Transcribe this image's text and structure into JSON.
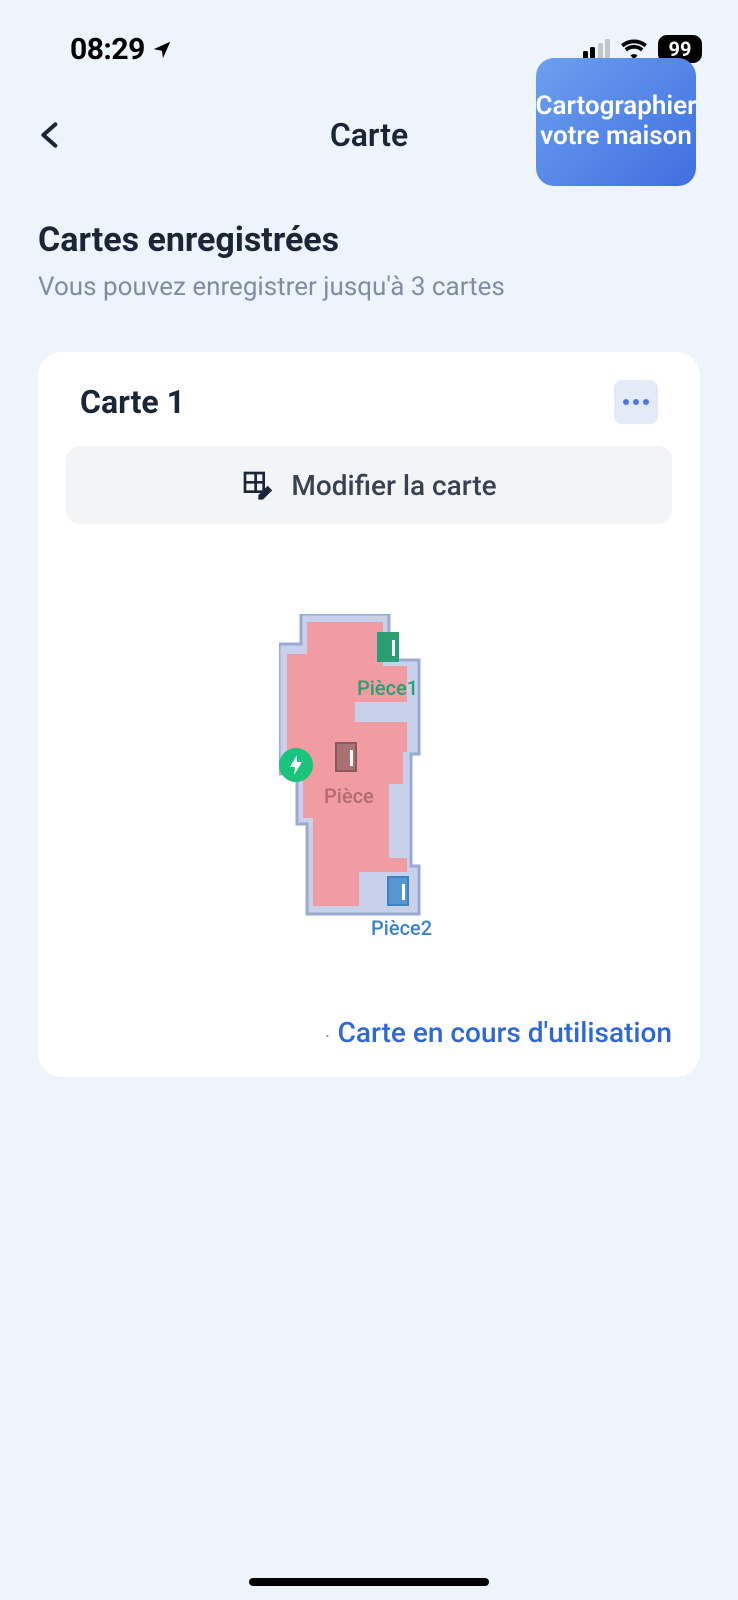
{
  "status_bar": {
    "time": "08:29",
    "battery_pct": "99"
  },
  "header": {
    "title": "Carte",
    "map_home_button": "Cartographier votre maison"
  },
  "section": {
    "title": "Cartes enregistrées",
    "subtitle": "Vous pouvez enregistrer jusqu'à 3 cartes"
  },
  "map_card": {
    "title": "Carte 1",
    "edit_button": "Modifier la carte",
    "rooms": {
      "piece1": "Pièce1",
      "piece": "Pièce",
      "piece2": "Pièce2"
    },
    "status": "Carte en cours d'utilisation"
  }
}
